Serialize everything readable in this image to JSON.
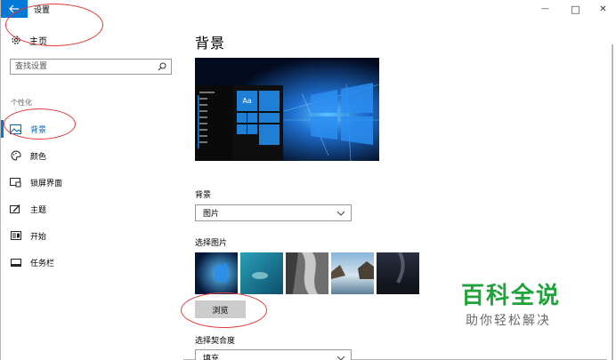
{
  "window": {
    "title": "设置",
    "minimize_symbol": "—",
    "maximize_symbol": "□",
    "close_symbol": "✕"
  },
  "sidebar": {
    "home_label": "主页",
    "search_placeholder": "查找设置",
    "section_label": "个性化",
    "items": [
      {
        "label": "背景",
        "icon": "picture-icon",
        "active": true
      },
      {
        "label": "颜色",
        "icon": "palette-icon",
        "active": false
      },
      {
        "label": "锁屏界面",
        "icon": "lock-screen-icon",
        "active": false
      },
      {
        "label": "主题",
        "icon": "brush-icon",
        "active": false
      },
      {
        "label": "开始",
        "icon": "start-icon",
        "active": false
      },
      {
        "label": "任务栏",
        "icon": "taskbar-icon",
        "active": false
      }
    ]
  },
  "main": {
    "title": "背景",
    "preview_tile_text": "Aa",
    "background_label": "背景",
    "background_value": "图片",
    "choose_picture_label": "选择图片",
    "browse_label": "浏览",
    "fit_label": "选择契合度",
    "fit_value": "填充"
  },
  "watermark": {
    "title": "百科全说",
    "subtitle": "助你轻松解决"
  },
  "colors": {
    "accent": "#0078d7",
    "annotation": "#e23a3a",
    "watermark_green": "#1fa33a"
  }
}
